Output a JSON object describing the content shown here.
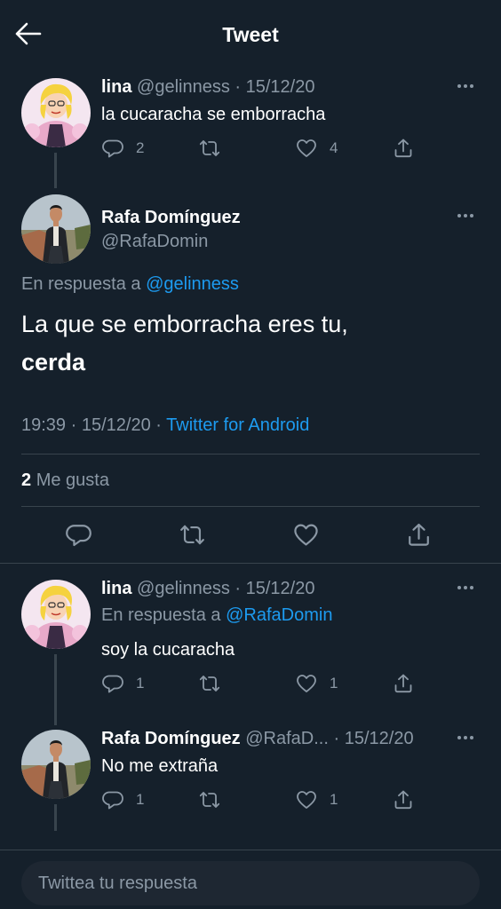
{
  "header": {
    "title": "Tweet"
  },
  "tweet1": {
    "name": "lina",
    "handle": "@gelinness",
    "sep": "·",
    "date": "15/12/20",
    "text": "la cucaracha se emborracha",
    "replies": "2",
    "likes": "4"
  },
  "main": {
    "name": "Rafa Domínguez",
    "handle": "@RafaDomin",
    "reply_prefix": "En respuesta a",
    "reply_to": "@gelinness",
    "text_line1": "La que se emborracha eres tu,",
    "text_line2": "cerda",
    "time": "19:39",
    "sep1": "·",
    "date": "15/12/20",
    "sep2": "·",
    "source": "Twitter for Android",
    "likes_count": "2",
    "likes_label": "Me gusta"
  },
  "tweet3": {
    "name": "lina",
    "handle": "@gelinness",
    "sep": "·",
    "date": "15/12/20",
    "reply_prefix": "En respuesta a",
    "reply_to": "@RafaDomin",
    "text": "soy la cucaracha",
    "replies": "1",
    "likes": "1"
  },
  "tweet4": {
    "name": "Rafa Domínguez",
    "handle": "@RafaD...",
    "sep": "·",
    "date": "15/12/20",
    "text": "No me extraña",
    "replies": "1",
    "likes": "1"
  },
  "composer": {
    "placeholder": "Twittea tu respuesta"
  },
  "colors": {
    "background": "#15202b",
    "accent": "#1d9bf0",
    "muted": "#8b98a5",
    "divider": "#38444d"
  }
}
